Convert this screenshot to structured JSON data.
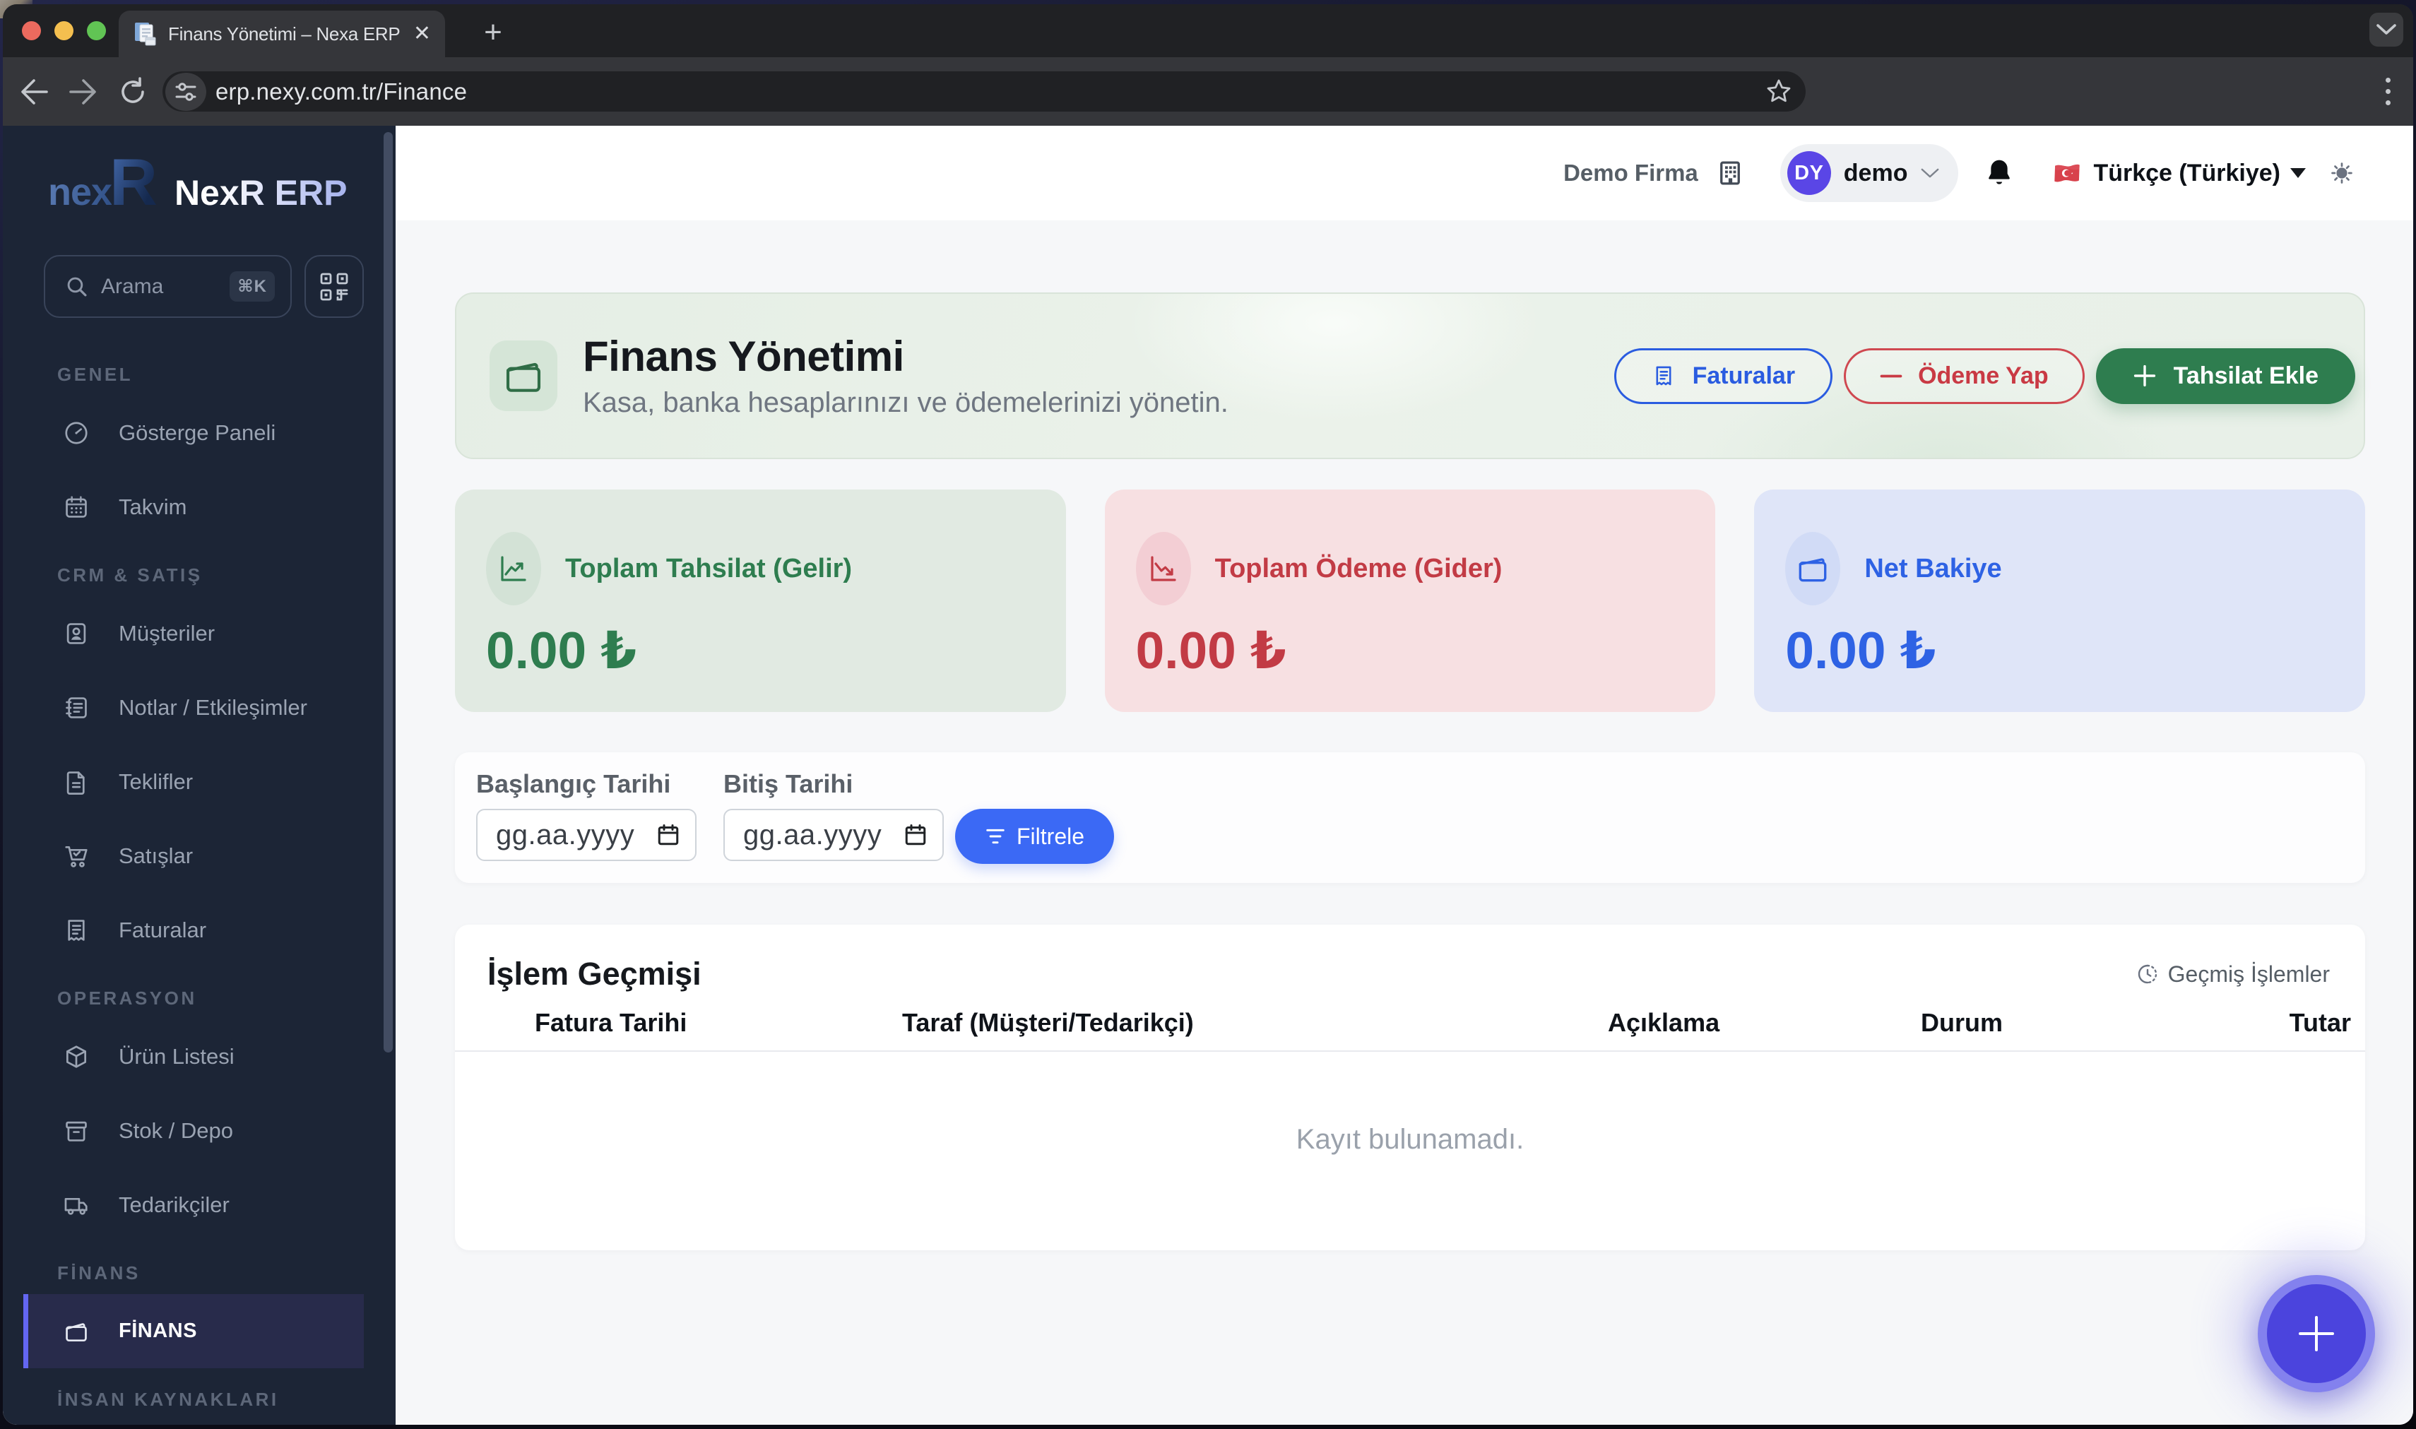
{
  "browser": {
    "tab_title": "Finans Yönetimi – Nexa ERP",
    "tab_close": "✕",
    "new_tab": "+",
    "url": "erp.nexy.com.tr/Finance"
  },
  "sidebar": {
    "logo_nex": "nex",
    "logo_r": "R",
    "logo_title": "NexR ERP",
    "search_placeholder": "Arama",
    "search_shortcut": "⌘K",
    "sections": [
      {
        "label": "GENEL",
        "items": [
          {
            "label": "Gösterge Paneli"
          },
          {
            "label": "Takvim"
          }
        ]
      },
      {
        "label": "CRM & SATIŞ",
        "items": [
          {
            "label": "Müşteriler"
          },
          {
            "label": "Notlar / Etkileşimler"
          },
          {
            "label": "Teklifler"
          },
          {
            "label": "Satışlar"
          },
          {
            "label": "Faturalar"
          }
        ]
      },
      {
        "label": "OPERASYON",
        "items": [
          {
            "label": "Ürün Listesi"
          },
          {
            "label": "Stok / Depo"
          },
          {
            "label": "Tedarikçiler"
          }
        ]
      },
      {
        "label": "FİNANS",
        "items": [
          {
            "label": "FİNANS",
            "active": true
          }
        ]
      },
      {
        "label": "İNSAN KAYNAKLARI",
        "items": []
      }
    ]
  },
  "header": {
    "company": "Demo Firma",
    "avatar_initials": "DY",
    "username": "demo",
    "language": "Türkçe (Türkiye)"
  },
  "hero": {
    "title": "Finans Yönetimi",
    "subtitle": "Kasa, banka hesaplarınızı ve ödemelerinizi yönetin.",
    "btn_invoices": "Faturalar",
    "btn_pay": "Ödeme Yap",
    "btn_collect": "Tahsilat Ekle"
  },
  "stats": [
    {
      "label": "Toplam Tahsilat (Gelir)",
      "value": "0.00 ₺",
      "color": "#2e7d4f"
    },
    {
      "label": "Toplam Ödeme (Gider)",
      "value": "0.00 ₺",
      "color": "#c23b45"
    },
    {
      "label": "Net Bakiye",
      "value": "0.00 ₺",
      "color": "#2e62e4"
    }
  ],
  "filter": {
    "start_label": "Başlangıç Tarihi",
    "end_label": "Bitiş Tarihi",
    "date_placeholder": "gg.aa.yyyy",
    "button": "Filtrele"
  },
  "table": {
    "title": "İşlem Geçmişi",
    "history_link": "Geçmiş İşlemler",
    "columns": [
      "Fatura Tarihi",
      "Taraf (Müşteri/Tedarikçi)",
      "Açıklama",
      "Durum",
      "Tutar"
    ],
    "empty": "Kayıt bulunamadı."
  },
  "colors": {
    "accent_indigo": "#6366f1",
    "green": "#2e7d4f",
    "red": "#c23b45",
    "blue": "#2e62e4",
    "filter_blue": "#3e6af2"
  }
}
